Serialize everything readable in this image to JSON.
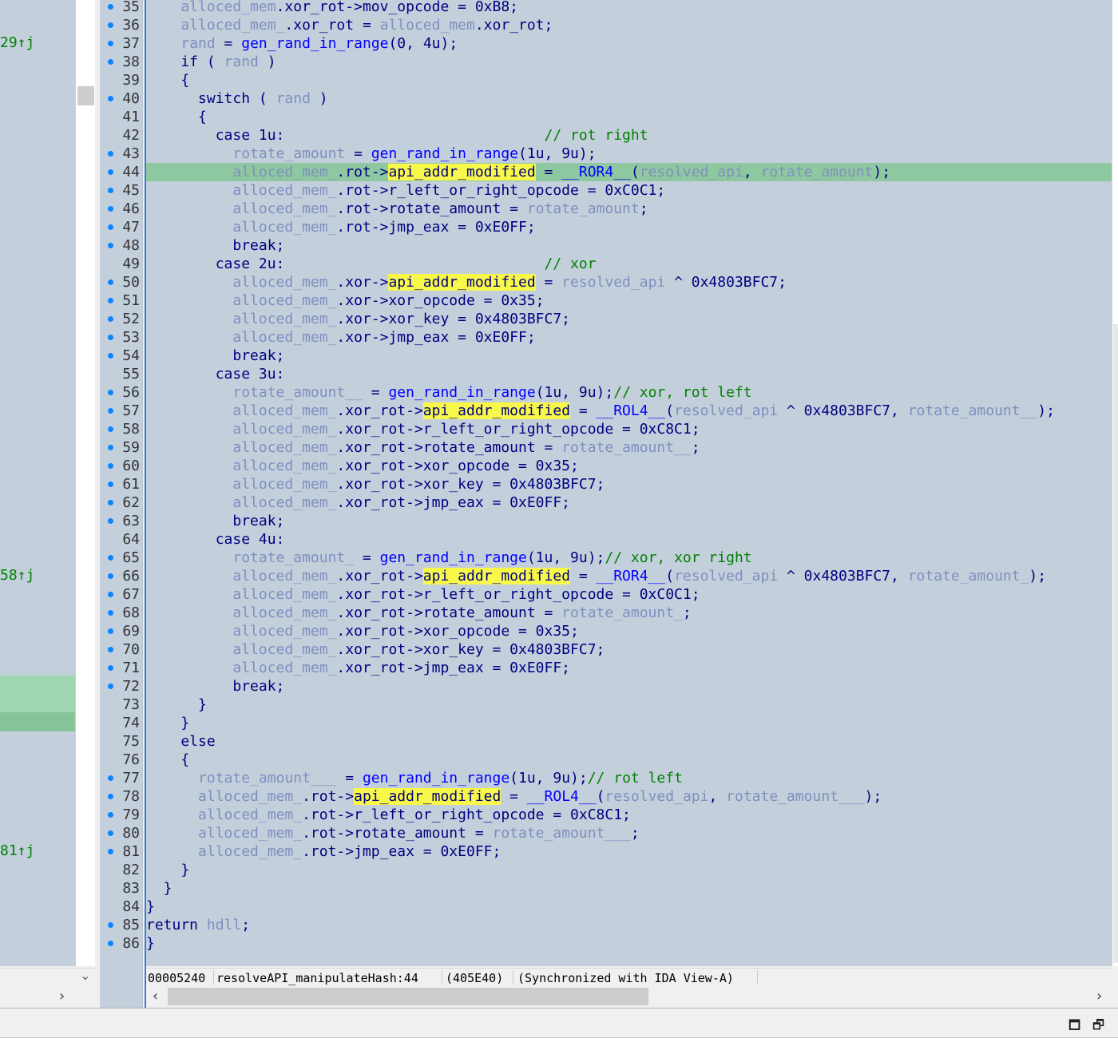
{
  "xrefs": [
    {
      "label": "29↑j",
      "line": 37
    },
    {
      "label": "58↑j",
      "line": 66
    },
    {
      "label": "81↑j",
      "line": 81
    }
  ],
  "highlighted_line": 44,
  "lines": [
    {
      "n": 35,
      "dot": true,
      "t": [
        [
          "    ",
          ""
        ],
        [
          "alloced_mem",
          "v"
        ],
        [
          ".xor_rot->mov_opcode = 0xB8;",
          ""
        ]
      ]
    },
    {
      "n": 36,
      "dot": true,
      "t": [
        [
          "    ",
          ""
        ],
        [
          "alloced_mem_",
          "v"
        ],
        [
          ".xor_rot = ",
          ""
        ],
        [
          "alloced_mem",
          "v"
        ],
        [
          ".xor_rot;",
          ""
        ]
      ]
    },
    {
      "n": 37,
      "dot": true,
      "t": [
        [
          "    ",
          ""
        ],
        [
          "rand",
          "v"
        ],
        [
          " = ",
          ""
        ],
        [
          "gen_rand_in_range",
          "f"
        ],
        [
          "(0, 4u);",
          ""
        ]
      ]
    },
    {
      "n": 38,
      "dot": true,
      "t": [
        [
          "    if ( ",
          ""
        ],
        [
          "rand",
          "v"
        ],
        [
          " )",
          ""
        ]
      ]
    },
    {
      "n": 39,
      "dot": false,
      "t": [
        [
          "    {",
          ""
        ]
      ]
    },
    {
      "n": 40,
      "dot": true,
      "t": [
        [
          "      switch ( ",
          ""
        ],
        [
          "rand",
          "v"
        ],
        [
          " )",
          ""
        ]
      ]
    },
    {
      "n": 41,
      "dot": false,
      "t": [
        [
          "      {",
          ""
        ]
      ]
    },
    {
      "n": 42,
      "dot": false,
      "t": [
        [
          "        case 1u:                              ",
          ""
        ],
        [
          "// rot right",
          "c"
        ]
      ]
    },
    {
      "n": 43,
      "dot": true,
      "t": [
        [
          "          ",
          ""
        ],
        [
          "rotate_amount",
          "v"
        ],
        [
          " = ",
          ""
        ],
        [
          "gen_rand_in_range",
          "f"
        ],
        [
          "(1u, 9u);",
          ""
        ]
      ]
    },
    {
      "n": 44,
      "dot": true,
      "t": [
        [
          "          ",
          ""
        ],
        [
          "alloced_mem_",
          "v"
        ],
        [
          ".rot->",
          ""
        ],
        [
          "api_addr_modified",
          "y"
        ],
        [
          " = ",
          ""
        ],
        [
          "__ROR4__",
          "f"
        ],
        [
          "(",
          ""
        ],
        [
          "resolved_api",
          "v"
        ],
        [
          ", ",
          ""
        ],
        [
          "rotate_amount",
          "v"
        ],
        [
          ");",
          ""
        ]
      ]
    },
    {
      "n": 45,
      "dot": true,
      "t": [
        [
          "          ",
          ""
        ],
        [
          "alloced_mem_",
          "v"
        ],
        [
          ".rot->r_left_or_right_opcode = 0xC0C1;",
          ""
        ]
      ]
    },
    {
      "n": 46,
      "dot": true,
      "t": [
        [
          "          ",
          ""
        ],
        [
          "alloced_mem_",
          "v"
        ],
        [
          ".rot->rotate_amount = ",
          ""
        ],
        [
          "rotate_amount",
          "v"
        ],
        [
          ";",
          ""
        ]
      ]
    },
    {
      "n": 47,
      "dot": true,
      "t": [
        [
          "          ",
          ""
        ],
        [
          "alloced_mem_",
          "v"
        ],
        [
          ".rot->jmp_eax = 0xE0FF;",
          ""
        ]
      ]
    },
    {
      "n": 48,
      "dot": true,
      "t": [
        [
          "          break;",
          ""
        ]
      ]
    },
    {
      "n": 49,
      "dot": false,
      "t": [
        [
          "        case 2u:                              ",
          ""
        ],
        [
          "// xor",
          "c"
        ]
      ]
    },
    {
      "n": 50,
      "dot": true,
      "t": [
        [
          "          ",
          ""
        ],
        [
          "alloced_mem_",
          "v"
        ],
        [
          ".xor->",
          ""
        ],
        [
          "api_addr_modified",
          "y"
        ],
        [
          " = ",
          ""
        ],
        [
          "resolved_api",
          "v"
        ],
        [
          " ^ 0x4803BFC7;",
          ""
        ]
      ]
    },
    {
      "n": 51,
      "dot": true,
      "t": [
        [
          "          ",
          ""
        ],
        [
          "alloced_mem_",
          "v"
        ],
        [
          ".xor->xor_opcode = 0x35;",
          ""
        ]
      ]
    },
    {
      "n": 52,
      "dot": true,
      "t": [
        [
          "          ",
          ""
        ],
        [
          "alloced_mem_",
          "v"
        ],
        [
          ".xor->xor_key = 0x4803BFC7;",
          ""
        ]
      ]
    },
    {
      "n": 53,
      "dot": true,
      "t": [
        [
          "          ",
          ""
        ],
        [
          "alloced_mem_",
          "v"
        ],
        [
          ".xor->jmp_eax = 0xE0FF;",
          ""
        ]
      ]
    },
    {
      "n": 54,
      "dot": true,
      "t": [
        [
          "          break;",
          ""
        ]
      ]
    },
    {
      "n": 55,
      "dot": false,
      "t": [
        [
          "        case 3u:",
          ""
        ]
      ]
    },
    {
      "n": 56,
      "dot": true,
      "t": [
        [
          "          ",
          ""
        ],
        [
          "rotate_amount__",
          "v"
        ],
        [
          " = ",
          ""
        ],
        [
          "gen_rand_in_range",
          "f"
        ],
        [
          "(1u, 9u);",
          ""
        ],
        [
          "// xor, rot left",
          "c"
        ]
      ]
    },
    {
      "n": 57,
      "dot": true,
      "t": [
        [
          "          ",
          ""
        ],
        [
          "alloced_mem_",
          "v"
        ],
        [
          ".xor_rot->",
          ""
        ],
        [
          "api_addr_modified",
          "y"
        ],
        [
          " = ",
          ""
        ],
        [
          "__ROL4__",
          "f"
        ],
        [
          "(",
          ""
        ],
        [
          "resolved_api",
          "v"
        ],
        [
          " ^ 0x4803BFC7, ",
          ""
        ],
        [
          "rotate_amount__",
          "v"
        ],
        [
          ");",
          ""
        ]
      ]
    },
    {
      "n": 58,
      "dot": true,
      "t": [
        [
          "          ",
          ""
        ],
        [
          "alloced_mem_",
          "v"
        ],
        [
          ".xor_rot->r_left_or_right_opcode = 0xC8C1;",
          ""
        ]
      ]
    },
    {
      "n": 59,
      "dot": true,
      "t": [
        [
          "          ",
          ""
        ],
        [
          "alloced_mem_",
          "v"
        ],
        [
          ".xor_rot->rotate_amount = ",
          ""
        ],
        [
          "rotate_amount__",
          "v"
        ],
        [
          ";",
          ""
        ]
      ]
    },
    {
      "n": 60,
      "dot": true,
      "t": [
        [
          "          ",
          ""
        ],
        [
          "alloced_mem_",
          "v"
        ],
        [
          ".xor_rot->xor_opcode = 0x35;",
          ""
        ]
      ]
    },
    {
      "n": 61,
      "dot": true,
      "t": [
        [
          "          ",
          ""
        ],
        [
          "alloced_mem_",
          "v"
        ],
        [
          ".xor_rot->xor_key = 0x4803BFC7;",
          ""
        ]
      ]
    },
    {
      "n": 62,
      "dot": true,
      "t": [
        [
          "          ",
          ""
        ],
        [
          "alloced_mem_",
          "v"
        ],
        [
          ".xor_rot->jmp_eax = 0xE0FF;",
          ""
        ]
      ]
    },
    {
      "n": 63,
      "dot": true,
      "t": [
        [
          "          break;",
          ""
        ]
      ]
    },
    {
      "n": 64,
      "dot": false,
      "t": [
        [
          "        case 4u:",
          ""
        ]
      ]
    },
    {
      "n": 65,
      "dot": true,
      "t": [
        [
          "          ",
          ""
        ],
        [
          "rotate_amount_",
          "v"
        ],
        [
          " = ",
          ""
        ],
        [
          "gen_rand_in_range",
          "f"
        ],
        [
          "(1u, 9u);",
          ""
        ],
        [
          "// xor, xor right",
          "c"
        ]
      ]
    },
    {
      "n": 66,
      "dot": true,
      "t": [
        [
          "          ",
          ""
        ],
        [
          "alloced_mem_",
          "v"
        ],
        [
          ".xor_rot->",
          ""
        ],
        [
          "api_addr_modified",
          "y"
        ],
        [
          " = ",
          ""
        ],
        [
          "__ROR4__",
          "f"
        ],
        [
          "(",
          ""
        ],
        [
          "resolved_api",
          "v"
        ],
        [
          " ^ 0x4803BFC7, ",
          ""
        ],
        [
          "rotate_amount_",
          "v"
        ],
        [
          ");",
          ""
        ]
      ]
    },
    {
      "n": 67,
      "dot": true,
      "t": [
        [
          "          ",
          ""
        ],
        [
          "alloced_mem_",
          "v"
        ],
        [
          ".xor_rot->r_left_or_right_opcode = 0xC0C1;",
          ""
        ]
      ]
    },
    {
      "n": 68,
      "dot": true,
      "t": [
        [
          "          ",
          ""
        ],
        [
          "alloced_mem_",
          "v"
        ],
        [
          ".xor_rot->rotate_amount = ",
          ""
        ],
        [
          "rotate_amount_",
          "v"
        ],
        [
          ";",
          ""
        ]
      ]
    },
    {
      "n": 69,
      "dot": true,
      "t": [
        [
          "          ",
          ""
        ],
        [
          "alloced_mem_",
          "v"
        ],
        [
          ".xor_rot->xor_opcode = 0x35;",
          ""
        ]
      ]
    },
    {
      "n": 70,
      "dot": true,
      "t": [
        [
          "          ",
          ""
        ],
        [
          "alloced_mem_",
          "v"
        ],
        [
          ".xor_rot->xor_key = 0x4803BFC7;",
          ""
        ]
      ]
    },
    {
      "n": 71,
      "dot": true,
      "t": [
        [
          "          ",
          ""
        ],
        [
          "alloced_mem_",
          "v"
        ],
        [
          ".xor_rot->jmp_eax = 0xE0FF;",
          ""
        ]
      ]
    },
    {
      "n": 72,
      "dot": true,
      "t": [
        [
          "          break;",
          ""
        ]
      ]
    },
    {
      "n": 73,
      "dot": false,
      "t": [
        [
          "      }",
          ""
        ]
      ]
    },
    {
      "n": 74,
      "dot": false,
      "t": [
        [
          "    }",
          ""
        ]
      ]
    },
    {
      "n": 75,
      "dot": false,
      "t": [
        [
          "    else",
          ""
        ]
      ]
    },
    {
      "n": 76,
      "dot": false,
      "t": [
        [
          "    {",
          ""
        ]
      ]
    },
    {
      "n": 77,
      "dot": true,
      "t": [
        [
          "      ",
          ""
        ],
        [
          "rotate_amount___",
          "v"
        ],
        [
          " = ",
          ""
        ],
        [
          "gen_rand_in_range",
          "f"
        ],
        [
          "(1u, 9u);",
          ""
        ],
        [
          "// rot left",
          "c"
        ]
      ]
    },
    {
      "n": 78,
      "dot": true,
      "t": [
        [
          "      ",
          ""
        ],
        [
          "alloced_mem_",
          "v"
        ],
        [
          ".rot->",
          ""
        ],
        [
          "api_addr_modified",
          "y"
        ],
        [
          " = ",
          ""
        ],
        [
          "__ROL4__",
          "f"
        ],
        [
          "(",
          ""
        ],
        [
          "resolved_api",
          "v"
        ],
        [
          ", ",
          ""
        ],
        [
          "rotate_amount___",
          "v"
        ],
        [
          ");",
          ""
        ]
      ]
    },
    {
      "n": 79,
      "dot": true,
      "t": [
        [
          "      ",
          ""
        ],
        [
          "alloced_mem_",
          "v"
        ],
        [
          ".rot->r_left_or_right_opcode = 0xC8C1;",
          ""
        ]
      ]
    },
    {
      "n": 80,
      "dot": true,
      "t": [
        [
          "      ",
          ""
        ],
        [
          "alloced_mem_",
          "v"
        ],
        [
          ".rot->rotate_amount = ",
          ""
        ],
        [
          "rotate_amount___",
          "v"
        ],
        [
          ";",
          ""
        ]
      ]
    },
    {
      "n": 81,
      "dot": true,
      "t": [
        [
          "      ",
          ""
        ],
        [
          "alloced_mem_",
          "v"
        ],
        [
          ".rot->jmp_eax = 0xE0FF;",
          ""
        ]
      ]
    },
    {
      "n": 82,
      "dot": false,
      "t": [
        [
          "    }",
          ""
        ]
      ]
    },
    {
      "n": 83,
      "dot": false,
      "t": [
        [
          "  }",
          ""
        ]
      ]
    },
    {
      "n": 84,
      "dot": false,
      "t": [
        [
          "}",
          ""
        ]
      ]
    },
    {
      "n": 85,
      "dot": true,
      "t": [
        [
          "return ",
          ""
        ],
        [
          "hdll",
          "v"
        ],
        [
          ";",
          ""
        ]
      ]
    },
    {
      "n": 86,
      "dot": true,
      "t": [
        [
          "}",
          ""
        ]
      ]
    }
  ],
  "status": {
    "offset": "00005240",
    "location": "resolveAPI_manipulateHash:44",
    "address": "(405E40)",
    "sync": "(Synchronized with IDA View-A)"
  },
  "icons": {
    "left_scroll_down": "chevron-down-icon",
    "left_scroll_right": "chevron-right-icon",
    "hscroll_left": "chevron-left-icon",
    "hscroll_right": "chevron-right-icon",
    "maximize": "window-maximize-icon",
    "restore": "window-restore-icon"
  },
  "glyphs": {
    "down": "⌄",
    "left": "‹",
    "right": "›",
    "maximize": "🗖",
    "restore": "🗗"
  },
  "colors": {
    "background": "#c4cfdc",
    "highlight_row": "#8ec8a0",
    "identifier_highlight": "#f8f84a",
    "code_text": "#000080",
    "variable": "#7f8fbf",
    "function": "#0000ff",
    "comment": "#008000",
    "breakpoint_dot": "#0a84ff"
  }
}
